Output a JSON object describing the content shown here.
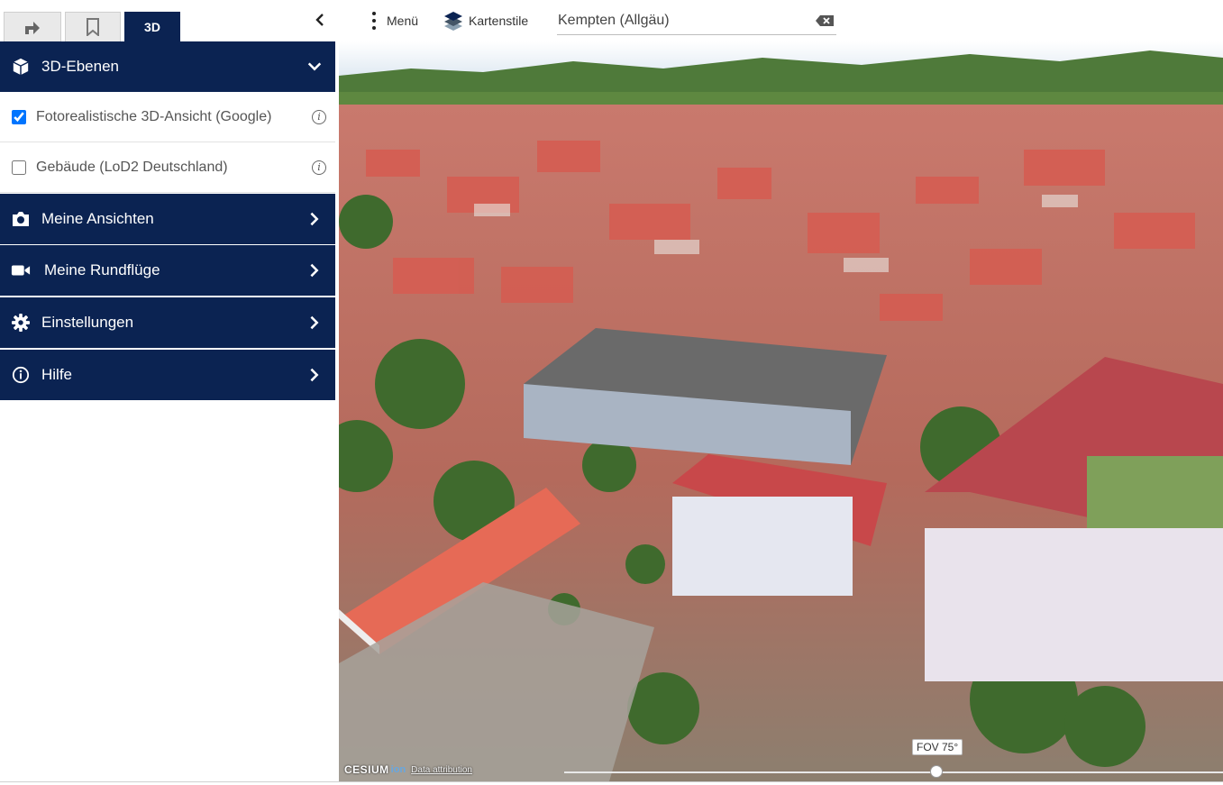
{
  "tabs": [
    {
      "icon": "share-arrow-icon"
    },
    {
      "icon": "bookmark-icon"
    },
    {
      "label": "3D"
    }
  ],
  "toolbar": {
    "menu_label": "Menü",
    "styles_label": "Kartenstile",
    "search_value": "Kempten (Allgäu)"
  },
  "sidebar": {
    "layers_header": "3D-Ebenen",
    "layers": [
      {
        "label": "Fotorealistische 3D-Ansicht (Google)",
        "checked": true
      },
      {
        "label": "Gebäude (LoD2 Deutschland)",
        "checked": false
      }
    ],
    "sections": [
      {
        "label": "Meine Ansichten",
        "icon": "camera-icon"
      },
      {
        "label": "Meine Rundflüge",
        "icon": "video-camera-icon"
      },
      {
        "label": "Einstellungen",
        "icon": "gear-icon"
      },
      {
        "label": "Hilfe",
        "icon": "info-icon"
      }
    ]
  },
  "map": {
    "credit_logo": "CESIUM",
    "credit_ion": "ion",
    "credit_link": "Data attribution",
    "fov_label": "FOV 75°",
    "fov_value": 75
  },
  "colors": {
    "primary": "#0b2352",
    "accent": "#1a73e8"
  }
}
